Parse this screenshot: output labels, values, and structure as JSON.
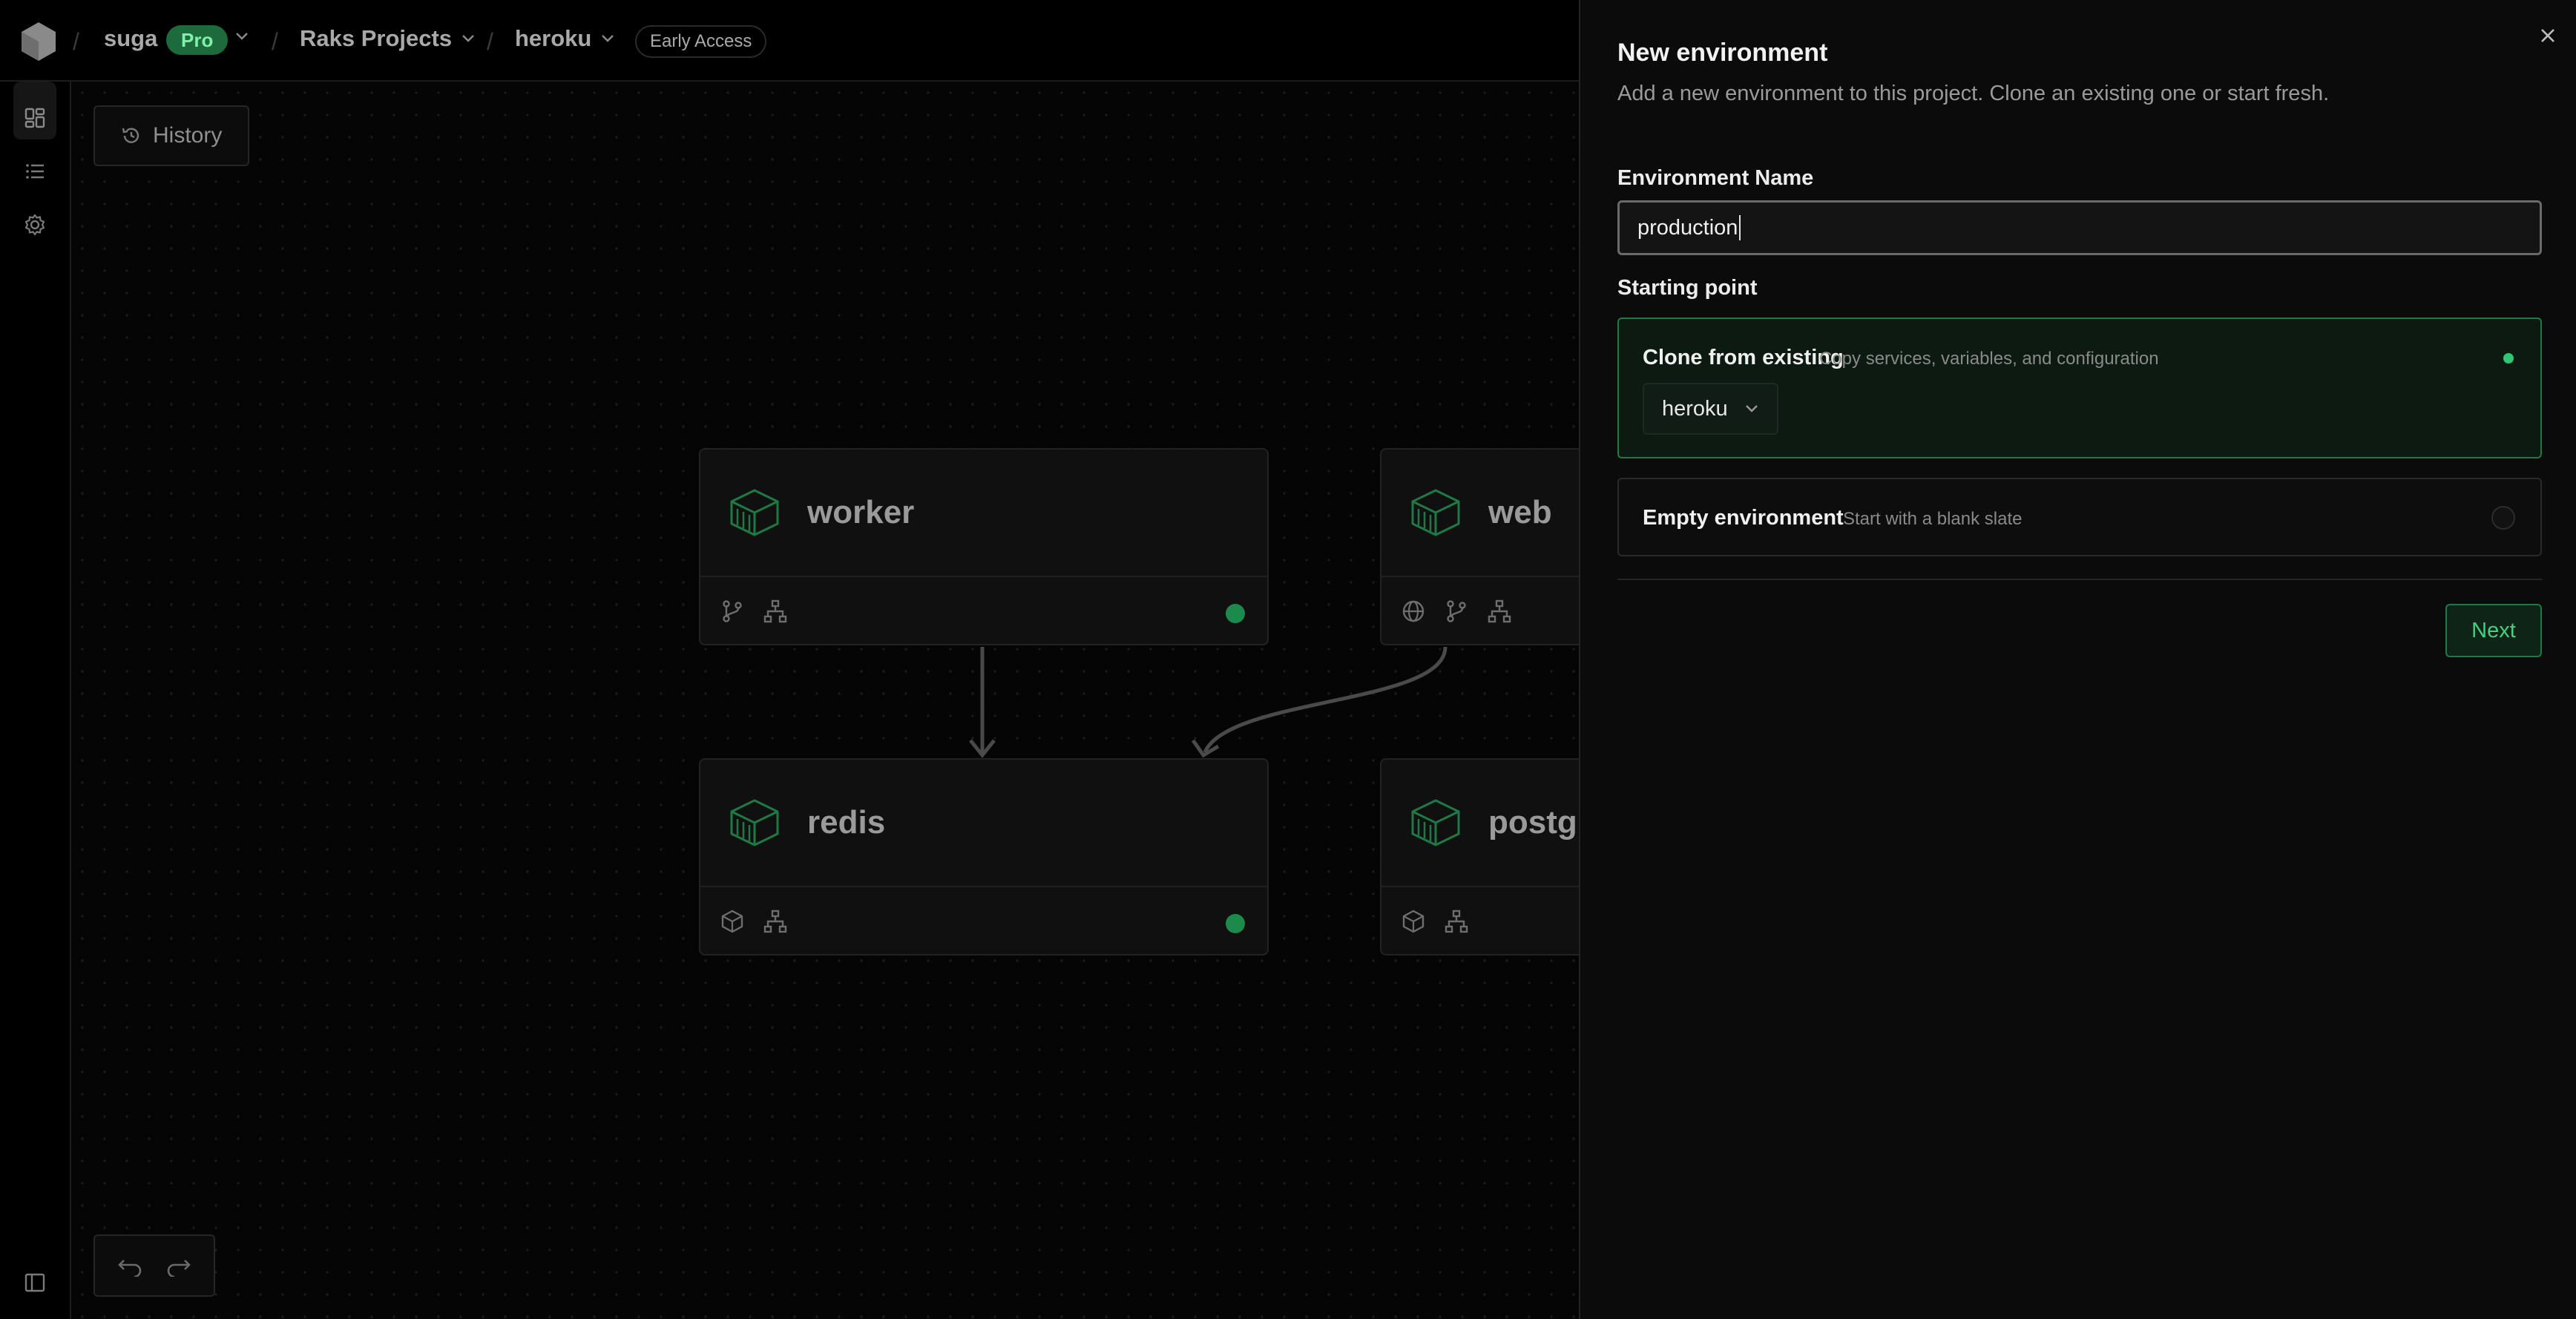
{
  "topbar": {
    "org": "suga",
    "plan_badge": "Pro",
    "project": "Raks Projects",
    "environment": "heroku",
    "access_badge": "Early Access"
  },
  "sidebar": {
    "items": [
      {
        "icon": "dashboard-icon",
        "active": true
      },
      {
        "icon": "list-icon",
        "active": false
      },
      {
        "icon": "gear-icon",
        "active": false
      }
    ],
    "bottom_icon": "sidebar-toggle-icon"
  },
  "canvas": {
    "history_label": "History",
    "nodes": [
      {
        "name": "worker",
        "icons": [
          "git-branch-icon",
          "network-icon"
        ],
        "status": "running"
      },
      {
        "name": "web",
        "icons": [
          "globe-icon",
          "git-branch-icon",
          "network-icon"
        ],
        "status": ""
      },
      {
        "name": "redis",
        "icons": [
          "box-icon",
          "network-icon"
        ],
        "status": "running"
      },
      {
        "name": "postg",
        "icons": [
          "box-icon",
          "network-icon"
        ],
        "status": ""
      }
    ]
  },
  "panel": {
    "title": "New environment",
    "subtitle": "Add a new environment to this project. Clone an existing one or start fresh.",
    "name_label": "Environment Name",
    "name_value": "production",
    "starting_point_label": "Starting point",
    "options": [
      {
        "title": "Clone from existing",
        "description": "Copy services, variables, and configuration",
        "selected": true,
        "source": "heroku"
      },
      {
        "title": "Empty environment",
        "description": "Start with a blank slate",
        "selected": false
      }
    ],
    "next_label": "Next"
  },
  "colors": {
    "accent": "#2ec774",
    "accent_dark": "#1f7a46",
    "background": "#000000",
    "panel": "#0b0b0b"
  }
}
